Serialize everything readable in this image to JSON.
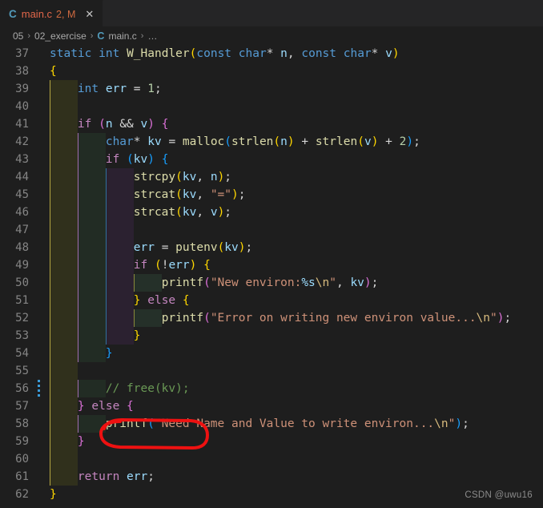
{
  "window": {
    "app": "Visual Studio Code",
    "theme": "Dark+",
    "colors": {
      "editor_bg": "#1e1e1e",
      "tabbar_bg": "#252526",
      "line_number": "#858585",
      "accent_modified": "#e2674a",
      "annotation_red": "#ee1111",
      "comment_green": "#6a9955",
      "string_orange": "#ce9178",
      "keyword_blue": "#569cd6",
      "control_magenta": "#c586c0",
      "function_yellow": "#dcdcaa",
      "variable_lightblue": "#9cdcfe"
    }
  },
  "tab": {
    "lang_icon": "c-language-icon",
    "lang_letter": "C",
    "filename": "main.c",
    "badge": "2, M",
    "close_glyph": "✕"
  },
  "breadcrumbs": {
    "separator": "›",
    "lang_letter": "C",
    "items": [
      {
        "label": "05"
      },
      {
        "label": "02_exercise"
      },
      {
        "label": "main.c",
        "has_icon": true
      }
    ],
    "more": "…"
  },
  "annotation": {
    "kind": "hand-drawn-red-oval",
    "target_line": 56,
    "target_text": "// free(kv);",
    "color": "#ee1111",
    "stroke_width": 4
  },
  "watermark": {
    "text": "CSDN @uwu16"
  },
  "editor": {
    "language": "c",
    "first_line": 37,
    "last_line": 62,
    "lines": [
      {
        "n": "37",
        "indent": 0,
        "mark": false,
        "tokens": [
          {
            "t": "static",
            "c": "t-kw"
          },
          {
            "t": " ",
            "c": "t-op"
          },
          {
            "t": "int",
            "c": "t-kw"
          },
          {
            "t": " ",
            "c": "t-op"
          },
          {
            "t": "W_Handler",
            "c": "t-fn"
          },
          {
            "t": "(",
            "c": "t-p0"
          },
          {
            "t": "const",
            "c": "t-kw"
          },
          {
            "t": " ",
            "c": "t-op"
          },
          {
            "t": "char",
            "c": "t-kw"
          },
          {
            "t": "*",
            "c": "t-op"
          },
          {
            "t": " ",
            "c": "t-op"
          },
          {
            "t": "n",
            "c": "t-var"
          },
          {
            "t": ",",
            "c": "t-op"
          },
          {
            "t": " ",
            "c": "t-op"
          },
          {
            "t": "const",
            "c": "t-kw"
          },
          {
            "t": " ",
            "c": "t-op"
          },
          {
            "t": "char",
            "c": "t-kw"
          },
          {
            "t": "*",
            "c": "t-op"
          },
          {
            "t": " ",
            "c": "t-op"
          },
          {
            "t": "v",
            "c": "t-var"
          },
          {
            "t": ")",
            "c": "t-p0"
          }
        ]
      },
      {
        "n": "38",
        "indent": 0,
        "mark": false,
        "tokens": [
          {
            "t": "{",
            "c": "t-p0"
          }
        ]
      },
      {
        "n": "39",
        "indent": 1,
        "mark": false,
        "tokens": [
          {
            "t": "    ",
            "c": "t-op"
          },
          {
            "t": "int",
            "c": "t-kw"
          },
          {
            "t": " ",
            "c": "t-op"
          },
          {
            "t": "err",
            "c": "t-var"
          },
          {
            "t": " ",
            "c": "t-op"
          },
          {
            "t": "=",
            "c": "t-op"
          },
          {
            "t": " ",
            "c": "t-op"
          },
          {
            "t": "1",
            "c": "t-num"
          },
          {
            "t": ";",
            "c": "t-op"
          }
        ]
      },
      {
        "n": "40",
        "indent": 1,
        "mark": false,
        "tokens": []
      },
      {
        "n": "41",
        "indent": 1,
        "mark": false,
        "tokens": [
          {
            "t": "    ",
            "c": "t-op"
          },
          {
            "t": "if",
            "c": "t-ctrl"
          },
          {
            "t": " ",
            "c": "t-op"
          },
          {
            "t": "(",
            "c": "t-p1"
          },
          {
            "t": "n",
            "c": "t-var"
          },
          {
            "t": " ",
            "c": "t-op"
          },
          {
            "t": "&&",
            "c": "t-op"
          },
          {
            "t": " ",
            "c": "t-op"
          },
          {
            "t": "v",
            "c": "t-var"
          },
          {
            "t": ")",
            "c": "t-p1"
          },
          {
            "t": " ",
            "c": "t-op"
          },
          {
            "t": "{",
            "c": "t-p1"
          }
        ]
      },
      {
        "n": "42",
        "indent": 2,
        "mark": false,
        "tokens": [
          {
            "t": "        ",
            "c": "t-op"
          },
          {
            "t": "char",
            "c": "t-kw"
          },
          {
            "t": "*",
            "c": "t-op"
          },
          {
            "t": " ",
            "c": "t-op"
          },
          {
            "t": "kv",
            "c": "t-var"
          },
          {
            "t": " ",
            "c": "t-op"
          },
          {
            "t": "=",
            "c": "t-op"
          },
          {
            "t": " ",
            "c": "t-op"
          },
          {
            "t": "malloc",
            "c": "t-fn"
          },
          {
            "t": "(",
            "c": "t-p2"
          },
          {
            "t": "strlen",
            "c": "t-fn"
          },
          {
            "t": "(",
            "c": "t-p0"
          },
          {
            "t": "n",
            "c": "t-var"
          },
          {
            "t": ")",
            "c": "t-p0"
          },
          {
            "t": " ",
            "c": "t-op"
          },
          {
            "t": "+",
            "c": "t-op"
          },
          {
            "t": " ",
            "c": "t-op"
          },
          {
            "t": "strlen",
            "c": "t-fn"
          },
          {
            "t": "(",
            "c": "t-p0"
          },
          {
            "t": "v",
            "c": "t-var"
          },
          {
            "t": ")",
            "c": "t-p0"
          },
          {
            "t": " ",
            "c": "t-op"
          },
          {
            "t": "+",
            "c": "t-op"
          },
          {
            "t": " ",
            "c": "t-op"
          },
          {
            "t": "2",
            "c": "t-num"
          },
          {
            "t": ")",
            "c": "t-p2"
          },
          {
            "t": ";",
            "c": "t-op"
          }
        ]
      },
      {
        "n": "43",
        "indent": 2,
        "mark": false,
        "tokens": [
          {
            "t": "        ",
            "c": "t-op"
          },
          {
            "t": "if",
            "c": "t-ctrl"
          },
          {
            "t": " ",
            "c": "t-op"
          },
          {
            "t": "(",
            "c": "t-p2"
          },
          {
            "t": "kv",
            "c": "t-var"
          },
          {
            "t": ")",
            "c": "t-p2"
          },
          {
            "t": " ",
            "c": "t-op"
          },
          {
            "t": "{",
            "c": "t-p2"
          }
        ]
      },
      {
        "n": "44",
        "indent": 3,
        "mark": false,
        "tokens": [
          {
            "t": "            ",
            "c": "t-op"
          },
          {
            "t": "strcpy",
            "c": "t-fn"
          },
          {
            "t": "(",
            "c": "t-p0"
          },
          {
            "t": "kv",
            "c": "t-var"
          },
          {
            "t": ",",
            "c": "t-op"
          },
          {
            "t": " ",
            "c": "t-op"
          },
          {
            "t": "n",
            "c": "t-var"
          },
          {
            "t": ")",
            "c": "t-p0"
          },
          {
            "t": ";",
            "c": "t-op"
          }
        ]
      },
      {
        "n": "45",
        "indent": 3,
        "mark": false,
        "tokens": [
          {
            "t": "            ",
            "c": "t-op"
          },
          {
            "t": "strcat",
            "c": "t-fn"
          },
          {
            "t": "(",
            "c": "t-p0"
          },
          {
            "t": "kv",
            "c": "t-var"
          },
          {
            "t": ",",
            "c": "t-op"
          },
          {
            "t": " ",
            "c": "t-op"
          },
          {
            "t": "\"=\"",
            "c": "t-str"
          },
          {
            "t": ")",
            "c": "t-p0"
          },
          {
            "t": ";",
            "c": "t-op"
          }
        ]
      },
      {
        "n": "46",
        "indent": 3,
        "mark": false,
        "tokens": [
          {
            "t": "            ",
            "c": "t-op"
          },
          {
            "t": "strcat",
            "c": "t-fn"
          },
          {
            "t": "(",
            "c": "t-p0"
          },
          {
            "t": "kv",
            "c": "t-var"
          },
          {
            "t": ",",
            "c": "t-op"
          },
          {
            "t": " ",
            "c": "t-op"
          },
          {
            "t": "v",
            "c": "t-var"
          },
          {
            "t": ")",
            "c": "t-p0"
          },
          {
            "t": ";",
            "c": "t-op"
          }
        ]
      },
      {
        "n": "47",
        "indent": 3,
        "mark": false,
        "tokens": []
      },
      {
        "n": "48",
        "indent": 3,
        "mark": false,
        "tokens": [
          {
            "t": "            ",
            "c": "t-op"
          },
          {
            "t": "err",
            "c": "t-var"
          },
          {
            "t": " ",
            "c": "t-op"
          },
          {
            "t": "=",
            "c": "t-op"
          },
          {
            "t": " ",
            "c": "t-op"
          },
          {
            "t": "putenv",
            "c": "t-fn"
          },
          {
            "t": "(",
            "c": "t-p0"
          },
          {
            "t": "kv",
            "c": "t-var"
          },
          {
            "t": ")",
            "c": "t-p0"
          },
          {
            "t": ";",
            "c": "t-op"
          }
        ]
      },
      {
        "n": "49",
        "indent": 3,
        "mark": false,
        "tokens": [
          {
            "t": "            ",
            "c": "t-op"
          },
          {
            "t": "if",
            "c": "t-ctrl"
          },
          {
            "t": " ",
            "c": "t-op"
          },
          {
            "t": "(",
            "c": "t-p0"
          },
          {
            "t": "!",
            "c": "t-op"
          },
          {
            "t": "err",
            "c": "t-var"
          },
          {
            "t": ")",
            "c": "t-p0"
          },
          {
            "t": " ",
            "c": "t-op"
          },
          {
            "t": "{",
            "c": "t-p0"
          }
        ]
      },
      {
        "n": "50",
        "indent": 4,
        "mark": false,
        "tokens": [
          {
            "t": "                ",
            "c": "t-op"
          },
          {
            "t": "printf",
            "c": "t-fn"
          },
          {
            "t": "(",
            "c": "t-p1"
          },
          {
            "t": "\"New environ:",
            "c": "t-str"
          },
          {
            "t": "%s",
            "c": "t-fmt"
          },
          {
            "t": "\\n",
            "c": "t-esc"
          },
          {
            "t": "\"",
            "c": "t-str"
          },
          {
            "t": ",",
            "c": "t-op"
          },
          {
            "t": " ",
            "c": "t-op"
          },
          {
            "t": "kv",
            "c": "t-var"
          },
          {
            "t": ")",
            "c": "t-p1"
          },
          {
            "t": ";",
            "c": "t-op"
          }
        ]
      },
      {
        "n": "51",
        "indent": 3,
        "mark": false,
        "tokens": [
          {
            "t": "            ",
            "c": "t-op"
          },
          {
            "t": "}",
            "c": "t-p0"
          },
          {
            "t": " ",
            "c": "t-op"
          },
          {
            "t": "else",
            "c": "t-ctrl"
          },
          {
            "t": " ",
            "c": "t-op"
          },
          {
            "t": "{",
            "c": "t-p0"
          }
        ]
      },
      {
        "n": "52",
        "indent": 4,
        "mark": false,
        "tokens": [
          {
            "t": "                ",
            "c": "t-op"
          },
          {
            "t": "printf",
            "c": "t-fn"
          },
          {
            "t": "(",
            "c": "t-p1"
          },
          {
            "t": "\"Error on writing new environ value...",
            "c": "t-str"
          },
          {
            "t": "\\n",
            "c": "t-esc"
          },
          {
            "t": "\"",
            "c": "t-str"
          },
          {
            "t": ")",
            "c": "t-p1"
          },
          {
            "t": ";",
            "c": "t-op"
          }
        ]
      },
      {
        "n": "53",
        "indent": 3,
        "mark": false,
        "tokens": [
          {
            "t": "            ",
            "c": "t-op"
          },
          {
            "t": "}",
            "c": "t-p0"
          }
        ]
      },
      {
        "n": "54",
        "indent": 2,
        "mark": false,
        "tokens": [
          {
            "t": "        ",
            "c": "t-op"
          },
          {
            "t": "}",
            "c": "t-p2"
          }
        ]
      },
      {
        "n": "55",
        "indent": 1,
        "mark": false,
        "tokens": []
      },
      {
        "n": "56",
        "indent": 2,
        "mark": true,
        "tokens": [
          {
            "t": "        ",
            "c": "t-op"
          },
          {
            "t": "// free(kv);",
            "c": "t-cmt"
          }
        ]
      },
      {
        "n": "57",
        "indent": 1,
        "mark": false,
        "tokens": [
          {
            "t": "    ",
            "c": "t-op"
          },
          {
            "t": "}",
            "c": "t-p1"
          },
          {
            "t": " ",
            "c": "t-op"
          },
          {
            "t": "else",
            "c": "t-ctrl"
          },
          {
            "t": " ",
            "c": "t-op"
          },
          {
            "t": "{",
            "c": "t-p1"
          }
        ]
      },
      {
        "n": "58",
        "indent": 2,
        "mark": false,
        "tokens": [
          {
            "t": "        ",
            "c": "t-op"
          },
          {
            "t": "printf",
            "c": "t-fn"
          },
          {
            "t": "(",
            "c": "t-p2"
          },
          {
            "t": "\"Need Name and Value to write environ...",
            "c": "t-str"
          },
          {
            "t": "\\n",
            "c": "t-esc"
          },
          {
            "t": "\"",
            "c": "t-str"
          },
          {
            "t": ")",
            "c": "t-p2"
          },
          {
            "t": ";",
            "c": "t-op"
          }
        ]
      },
      {
        "n": "59",
        "indent": 1,
        "mark": false,
        "tokens": [
          {
            "t": "    ",
            "c": "t-op"
          },
          {
            "t": "}",
            "c": "t-p1"
          }
        ]
      },
      {
        "n": "60",
        "indent": 1,
        "mark": false,
        "tokens": []
      },
      {
        "n": "61",
        "indent": 1,
        "mark": false,
        "tokens": [
          {
            "t": "    ",
            "c": "t-op"
          },
          {
            "t": "return",
            "c": "t-ctrl"
          },
          {
            "t": " ",
            "c": "t-op"
          },
          {
            "t": "err",
            "c": "t-var"
          },
          {
            "t": ";",
            "c": "t-op"
          }
        ]
      },
      {
        "n": "62",
        "indent": 0,
        "mark": false,
        "tokens": [
          {
            "t": "}",
            "c": "t-p0"
          }
        ]
      }
    ]
  }
}
